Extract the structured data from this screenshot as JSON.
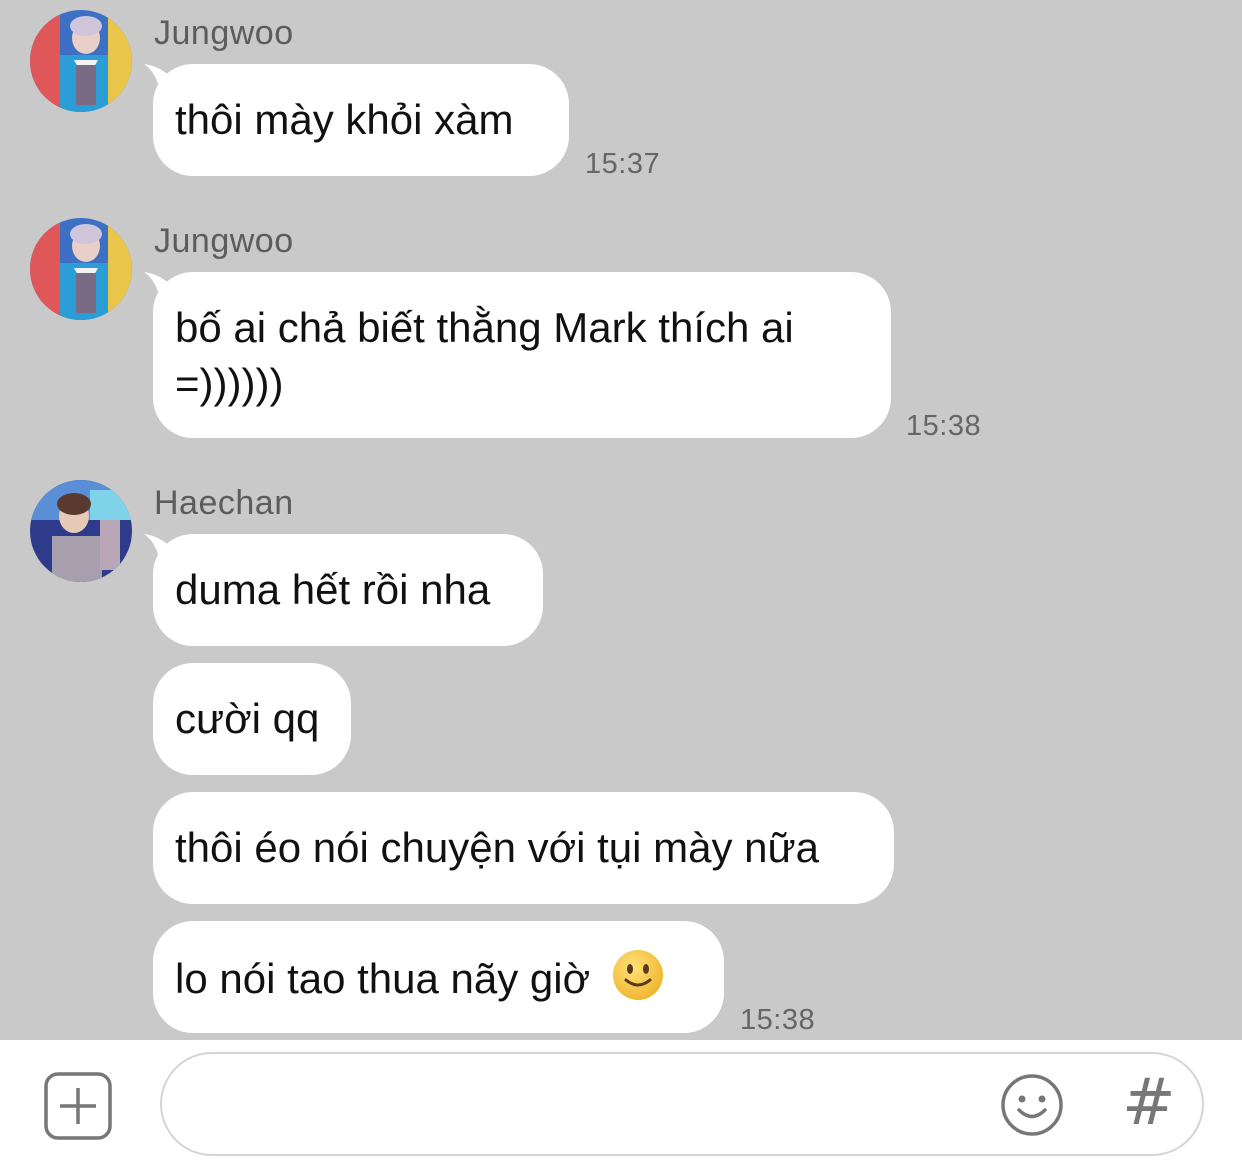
{
  "messages": [
    {
      "sender": "Jungwoo",
      "text": "thôi mày khỏi xàm",
      "time": "15:37"
    },
    {
      "sender": "Jungwoo",
      "line1": "bố ai chả biết thằng Mark thích ai",
      "line2": "=))))))",
      "time": "15:38"
    },
    {
      "sender": "Haechan",
      "texts": [
        "duma hết rồi nha",
        "cười qq",
        "thôi éo nói chuyện với tụi mày nữa",
        "lo nói tao thua nãy giờ"
      ],
      "time": "15:38"
    }
  ],
  "composer": {
    "hash_label": "#"
  },
  "colors": {
    "background": "#c9c9c9",
    "bubble": "#ffffff",
    "emoji": "#f5c33b"
  },
  "icons": [
    "add-icon",
    "emoji-icon",
    "hashtag-icon",
    "slightly-smiling-face-emoji"
  ]
}
